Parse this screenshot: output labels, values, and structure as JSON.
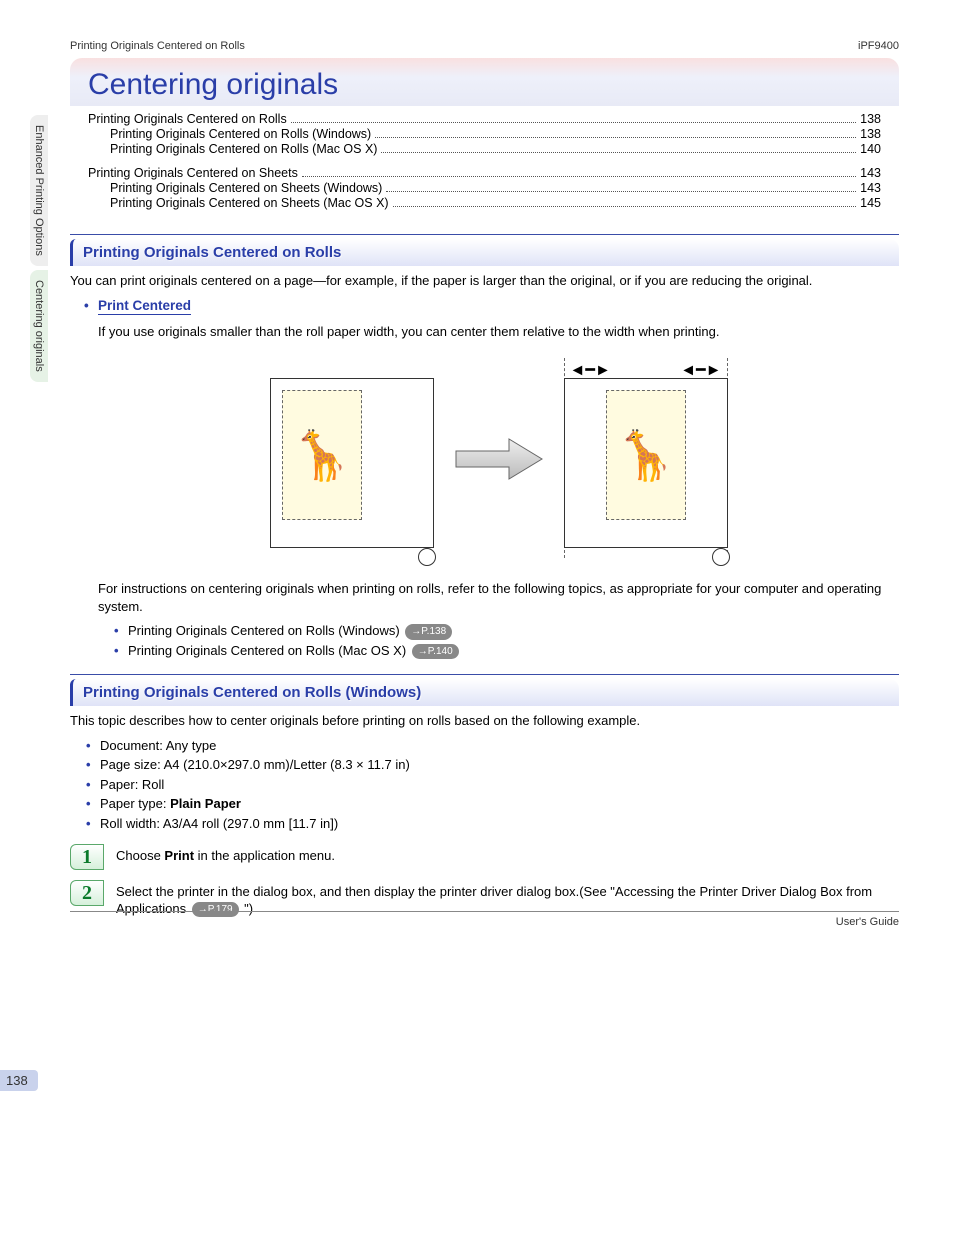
{
  "header": {
    "left": "Printing Originals Centered on Rolls",
    "right": "iPF9400"
  },
  "side": {
    "tab1": "Enhanced Printing Options",
    "tab2": "Centering originals"
  },
  "chapter": {
    "title": "Centering originals"
  },
  "toc": {
    "g1": {
      "r0": {
        "label": "Printing Originals Centered on Rolls",
        "page": "138"
      },
      "r1": {
        "label": "Printing Originals Centered on Rolls (Windows)",
        "page": "138"
      },
      "r2": {
        "label": "Printing Originals Centered on Rolls (Mac OS X)",
        "page": "140"
      }
    },
    "g2": {
      "r0": {
        "label": "Printing Originals Centered on Sheets",
        "page": "143"
      },
      "r1": {
        "label": "Printing Originals Centered on Sheets (Windows)",
        "page": "143"
      },
      "r2": {
        "label": "Printing Originals Centered on Sheets (Mac OS X)",
        "page": "145"
      }
    }
  },
  "sec1": {
    "title": "Printing Originals Centered on Rolls",
    "intro": "You can print originals centered on a page—for example, if the paper is larger than the original, or if you are reducing the original.",
    "sub_title": "Print Centered",
    "sub_para": "If you use originals smaller than the roll paper width, you can center them relative to the width when printing.",
    "note": "For instructions on centering originals when printing on rolls, refer to the following topics, as appropriate for your computer and operating system.",
    "link1": "Printing Originals Centered on Rolls (Windows)",
    "link1_ref": "→P.138",
    "link2": "Printing Originals Centered on Rolls (Mac OS X)",
    "link2_ref": "→P.140"
  },
  "sec2": {
    "title": "Printing Originals Centered on Rolls (Windows)",
    "intro": "This topic describes how to center originals before printing on rolls based on the following example.",
    "b1": "Document: Any type",
    "b2": "Page size: A4 (210.0×297.0 mm)/Letter (8.3 × 11.7 in)",
    "b3": "Paper: Roll",
    "b4_pre": "Paper type: ",
    "b4_bold": "Plain Paper",
    "b5": "Roll width: A3/A4 roll (297.0 mm [11.7 in])",
    "step1_pre": "Choose ",
    "step1_bold": "Print",
    "step1_post": " in the application menu.",
    "step2_a": "Select the printer in the dialog box, and then display the printer driver dialog box.(See \"Accessing the Printer Driver Dialog Box from Applications ",
    "step2_ref": "→P.179",
    "step2_b": " \")"
  },
  "pagenum": "138",
  "footer": "User's Guide",
  "glyph": {
    "giraffe": "🦒"
  }
}
